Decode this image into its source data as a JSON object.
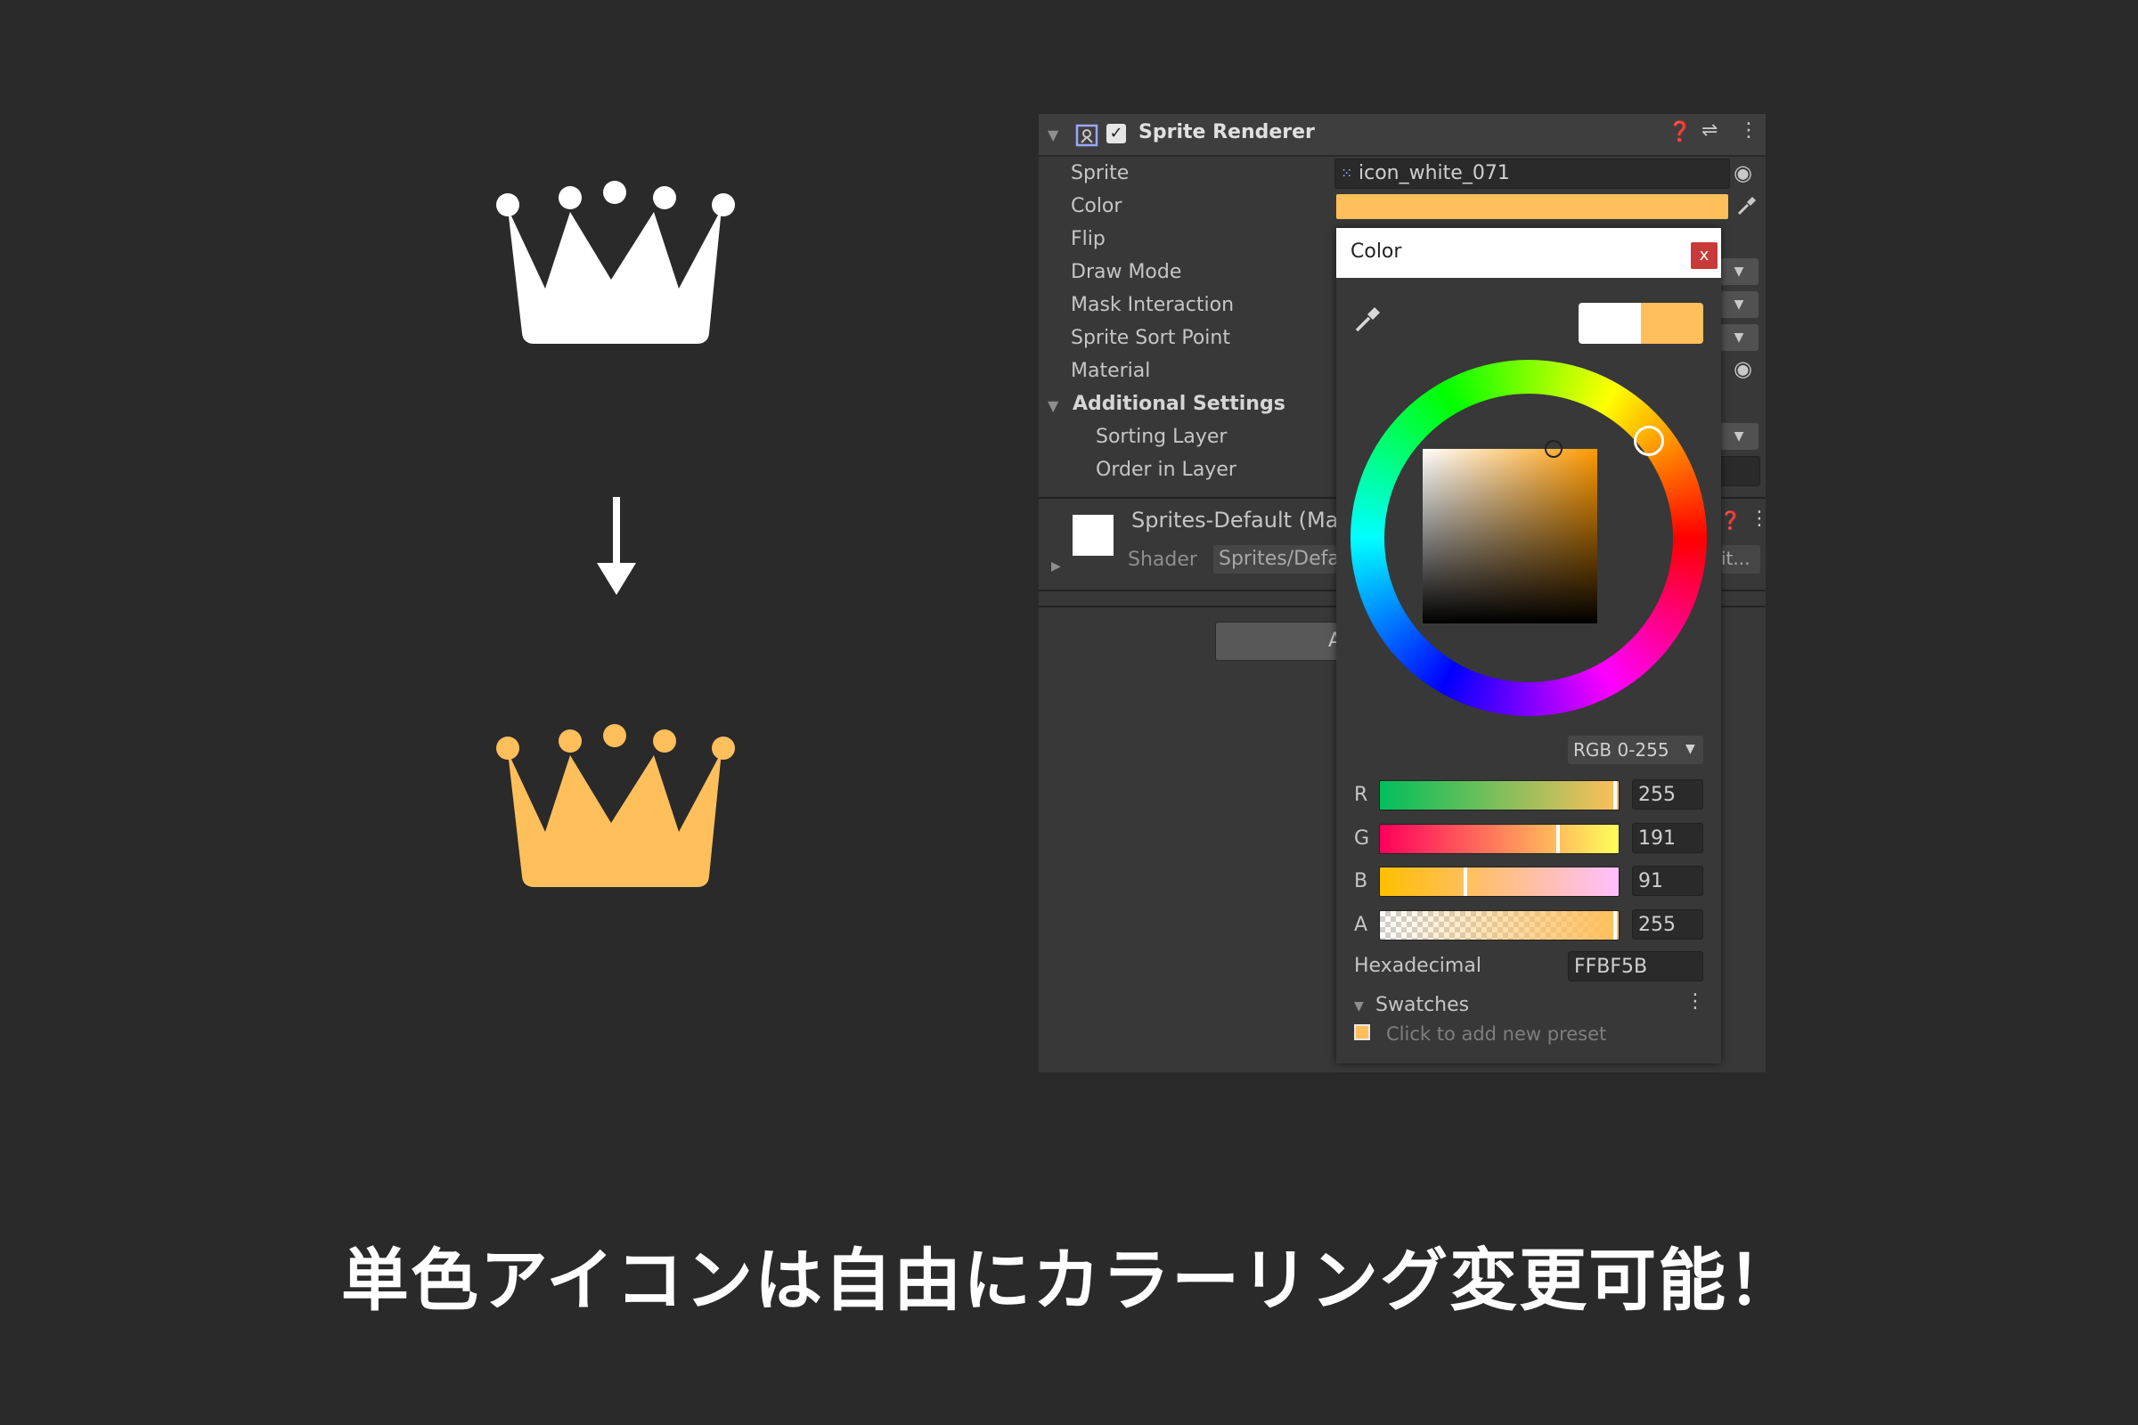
{
  "caption": "単色アイコンは自由にカラーリング変更可能！",
  "colors": {
    "original": "#ffffff",
    "tinted": "#ffbf5b",
    "accent_close": "#c83a3a"
  },
  "inspector": {
    "component_title": "Sprite Renderer",
    "header_icons": [
      "help-icon",
      "presets-icon",
      "more-options-icon"
    ],
    "properties": [
      {
        "label": "Sprite",
        "value": "icon_white_071"
      },
      {
        "label": "Color"
      },
      {
        "label": "Flip"
      },
      {
        "label": "Draw Mode"
      },
      {
        "label": "Mask Interaction"
      },
      {
        "label": "Sprite Sort Point"
      },
      {
        "label": "Material"
      }
    ],
    "additional_settings": {
      "label": "Additional Settings",
      "items": [
        "Sorting Layer",
        "Order in Layer"
      ]
    },
    "material": {
      "name": "Sprites-Default (Ma",
      "shader_label": "Shader",
      "shader_value": "Sprites/Defau",
      "edit_label": "it..."
    },
    "add_component_partial": "A"
  },
  "color_picker": {
    "title": "Color",
    "close_label": "x",
    "mode": "RGB 0-255",
    "channels": [
      {
        "label": "R",
        "value": "255"
      },
      {
        "label": "G",
        "value": "191"
      },
      {
        "label": "B",
        "value": "91"
      },
      {
        "label": "A",
        "value": "255"
      }
    ],
    "hex_label": "Hexadecimal",
    "hex_value": "FFBF5B",
    "swatches_label": "Swatches",
    "add_preset_label": "Click to add new preset"
  }
}
